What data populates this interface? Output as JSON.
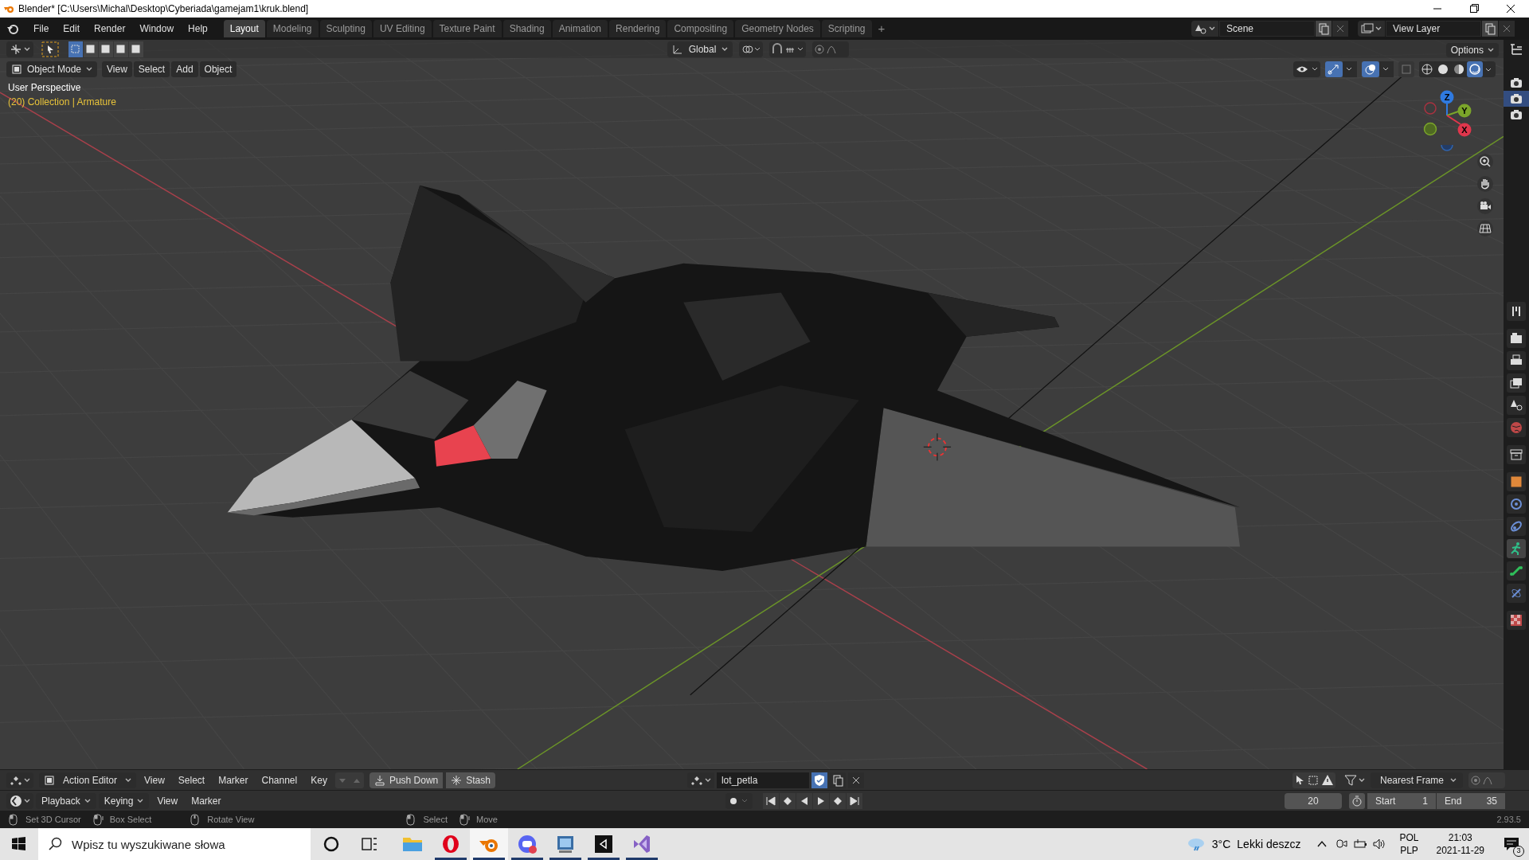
{
  "window": {
    "title": "Blender* [C:\\Users\\Michal\\Desktop\\Cyberiada\\gamejam1\\kruk.blend]"
  },
  "menu": [
    "File",
    "Edit",
    "Render",
    "Window",
    "Help"
  ],
  "workspace_tabs": [
    {
      "label": "Layout",
      "selected": true
    },
    {
      "label": "Modeling",
      "selected": false
    },
    {
      "label": "Sculpting",
      "selected": false
    },
    {
      "label": "UV Editing",
      "selected": false
    },
    {
      "label": "Texture Paint",
      "selected": false
    },
    {
      "label": "Shading",
      "selected": false
    },
    {
      "label": "Animation",
      "selected": false
    },
    {
      "label": "Rendering",
      "selected": false
    },
    {
      "label": "Compositing",
      "selected": false
    },
    {
      "label": "Geometry Nodes",
      "selected": false
    },
    {
      "label": "Scripting",
      "selected": false
    }
  ],
  "add_workspace": "+",
  "scene": {
    "value": "Scene"
  },
  "view_layer": {
    "value": "View Layer"
  },
  "viewport": {
    "transform_orientation": "Global",
    "options": "Options",
    "mode": "Object Mode",
    "menus": [
      "View",
      "Select",
      "Add",
      "Object"
    ],
    "overlay_lines": [
      "User Perspective",
      "(20) Collection | Armature"
    ],
    "shading_modes": [
      {
        "kind": "wireframe",
        "selected": false
      },
      {
        "kind": "solid",
        "selected": false
      },
      {
        "kind": "material",
        "selected": false
      },
      {
        "kind": "rendered",
        "selected": true
      }
    ],
    "gizmo": {
      "z": "Z",
      "y": "Y",
      "x": "X"
    }
  },
  "outliner_cameras": [
    {
      "selected": false
    },
    {
      "selected": true
    },
    {
      "selected": false
    }
  ],
  "properties_tabs": [
    {
      "kind": "tool",
      "selected": false
    },
    {
      "kind": "render",
      "selected": false
    },
    {
      "kind": "output",
      "selected": false
    },
    {
      "kind": "view-layer",
      "selected": false
    },
    {
      "kind": "scene",
      "selected": false
    },
    {
      "kind": "world",
      "selected": false
    },
    {
      "kind": "collection",
      "selected": false
    },
    {
      "kind": "object",
      "selected": false
    },
    {
      "kind": "physics",
      "selected": false
    },
    {
      "kind": "constraint",
      "selected": false
    },
    {
      "kind": "armature",
      "selected": true
    },
    {
      "kind": "bone",
      "selected": false
    },
    {
      "kind": "bone-constraint",
      "selected": false
    },
    {
      "kind": "texture",
      "selected": false
    }
  ],
  "action_editor": {
    "editor": "Action Editor",
    "menus": [
      "View",
      "Select",
      "Marker",
      "Channel",
      "Key"
    ],
    "push_down": "Push Down",
    "stash": "Stash",
    "action": "lot_petla",
    "snap": "Nearest Frame"
  },
  "timeline": {
    "menus": [
      {
        "label": "Playback",
        "dropdown": true
      },
      {
        "label": "Keying",
        "dropdown": true
      },
      {
        "label": "View",
        "dropdown": false
      },
      {
        "label": "Marker",
        "dropdown": false
      }
    ],
    "current_frame": "20",
    "start_label": "Start",
    "start": "1",
    "end_label": "End",
    "end": "35"
  },
  "status_bar": {
    "hints": [
      {
        "kind": "left",
        "label": "Set 3D Cursor"
      },
      {
        "kind": "drag",
        "label": "Box Select"
      },
      {
        "kind": "middle",
        "label": "Rotate View"
      },
      {
        "kind": "left",
        "label": "Select"
      },
      {
        "kind": "drag",
        "label": "Move"
      }
    ],
    "version": "2.93.5"
  },
  "taskbar": {
    "search_placeholder": "Wpisz tu wyszukiwane słowa",
    "apps": [
      {
        "kind": "cortana",
        "running": false,
        "selected": false
      },
      {
        "kind": "task-view",
        "running": false,
        "selected": false
      },
      {
        "kind": "explorer",
        "running": false,
        "selected": false
      },
      {
        "kind": "opera",
        "running": true,
        "selected": false
      },
      {
        "kind": "blender",
        "running": true,
        "selected": true
      },
      {
        "kind": "discord",
        "running": true,
        "selected": false
      },
      {
        "kind": "monitor",
        "running": true,
        "selected": false
      },
      {
        "kind": "unity",
        "running": true,
        "selected": false
      },
      {
        "kind": "visual-studio",
        "running": true,
        "selected": false
      }
    ],
    "temperature": "3°C",
    "weather": "Lekki deszcz",
    "language": [
      "POL",
      "PLP"
    ],
    "time": "21:03",
    "date": "2021-11-29",
    "notifications": "3"
  }
}
